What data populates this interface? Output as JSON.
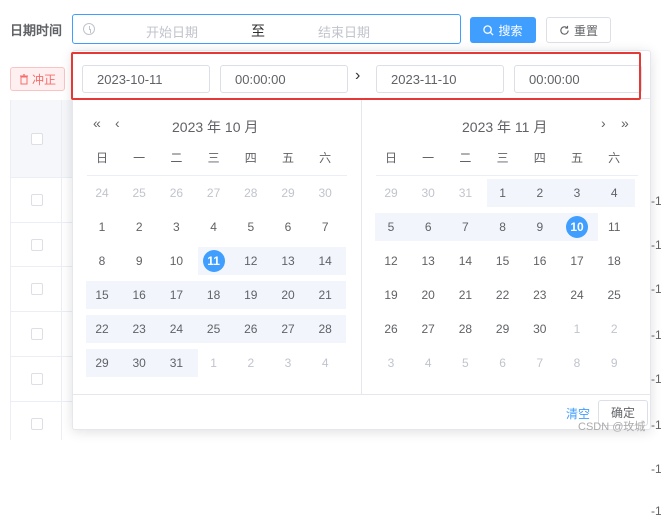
{
  "filter": {
    "label": "日期时间",
    "start_placeholder": "开始日期",
    "range_separator": "至",
    "end_placeholder": "结束日期"
  },
  "toolbar": {
    "search_label": "搜索",
    "reset_label": "重置",
    "offset_label": "冲正"
  },
  "table_edge_values": [
    "-1",
    "-1",
    "-1",
    "-1",
    "-1",
    "-1",
    "-1",
    "-1"
  ],
  "picker": {
    "start_date": "2023-10-11",
    "start_time": "00:00:00",
    "end_date": "2023-11-10",
    "end_time": "00:00:00",
    "range_arrow": "›",
    "weekdays": [
      "日",
      "一",
      "二",
      "三",
      "四",
      "五",
      "六"
    ],
    "left": {
      "title": "2023 年 10 月",
      "days": [
        [
          "24",
          "25",
          "26",
          "27",
          "28",
          "29",
          "30"
        ],
        [
          "1",
          "2",
          "3",
          "4",
          "5",
          "6",
          "7"
        ],
        [
          "8",
          "9",
          "10",
          "11",
          "12",
          "13",
          "14"
        ],
        [
          "15",
          "16",
          "17",
          "18",
          "19",
          "20",
          "21"
        ],
        [
          "22",
          "23",
          "24",
          "25",
          "26",
          "27",
          "28"
        ],
        [
          "29",
          "30",
          "31",
          "1",
          "2",
          "3",
          "4"
        ]
      ]
    },
    "right": {
      "title": "2023 年 11 月",
      "days": [
        [
          "29",
          "30",
          "31",
          "1",
          "2",
          "3",
          "4"
        ],
        [
          "5",
          "6",
          "7",
          "8",
          "9",
          "10",
          "11"
        ],
        [
          "12",
          "13",
          "14",
          "15",
          "16",
          "17",
          "18"
        ],
        [
          "19",
          "20",
          "21",
          "22",
          "23",
          "24",
          "25"
        ],
        [
          "26",
          "27",
          "28",
          "29",
          "30",
          "1",
          "2"
        ],
        [
          "3",
          "4",
          "5",
          "6",
          "7",
          "8",
          "9"
        ]
      ]
    },
    "clear_label": "清空",
    "ok_label": "确定"
  },
  "watermark": "CSDN @玫城",
  "colors": {
    "accent": "#409eff",
    "danger": "#f56c6c",
    "highlight_box": "#e53935"
  }
}
